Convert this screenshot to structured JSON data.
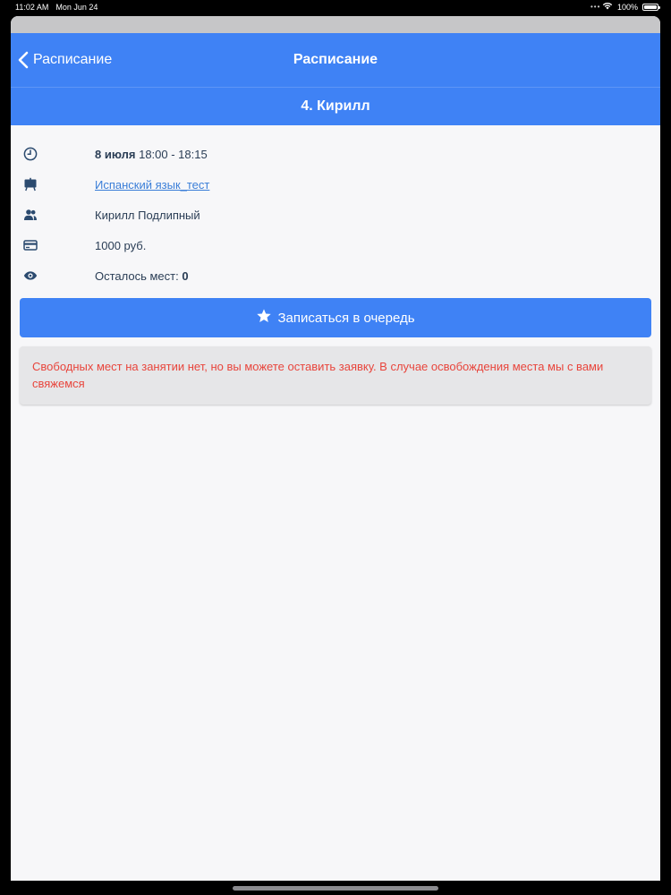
{
  "status_bar": {
    "time": "11:02 AM",
    "date": "Mon Jun 24",
    "dots": "•••",
    "battery_percent": "100%",
    "icons": [
      "wifi-icon",
      "battery-icon"
    ]
  },
  "nav": {
    "back_label": "Расписание",
    "title": "Расписание"
  },
  "sub_header": {
    "title": "4. Кирилл"
  },
  "details": {
    "date_bold": "8 июля",
    "time_range": "18:00 - 18:15",
    "course": "Испанский язык_тест",
    "teacher": "Кирилл Подлипный",
    "price": "1000 руб.",
    "seats_label": "Осталось мест:",
    "seats_value": "0"
  },
  "queue_button": {
    "label": "Записаться в очередь"
  },
  "notice": {
    "text": "Свободных мест на занятии нет, но вы можете оставить заявку. В случае освобождения места мы с вами свяжемся"
  },
  "colors": {
    "accent": "#3f82f5",
    "icon": "#2b4a6f",
    "link": "#3a7ed8",
    "warning_text": "#e8453c",
    "notice_bg": "#e6e6e8"
  }
}
